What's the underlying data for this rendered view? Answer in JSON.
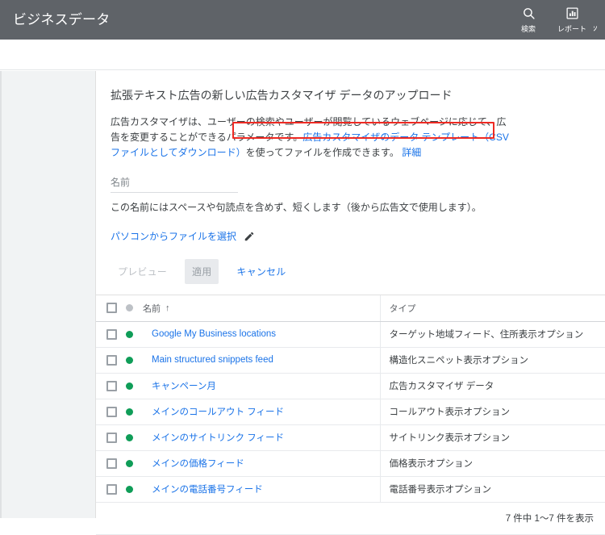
{
  "appbar": {
    "title": "ビジネスデータ",
    "actions": [
      {
        "label": "検索",
        "icon": "search-icon"
      },
      {
        "label": "レポート",
        "icon": "bar-chart-icon"
      },
      {
        "label": "ツ",
        "icon": "tools-icon"
      }
    ]
  },
  "panel": {
    "title": "拡張テキスト広告の新しい広告カスタマイザ データのアップロード",
    "description_before": "広告カスタマイザは、ユーザーの検索やユーザーが閲覧しているウェブページに応じて、広告を変更することができるパラメータです。",
    "template_link": "広告カスタマイザのデータ テンプレート（CSV ファイルとしてダウンロード）",
    "description_after": "を使ってファイルを作成できます。",
    "learn_more_link": "詳細",
    "name_field": {
      "placeholder": "名前",
      "value": ""
    },
    "name_hint": "この名前にはスペースや句読点を含めず、短くします（後から広告文で使用します）。",
    "file_pick_link": "パソコンからファイルを選択",
    "edit_icon": "pencil-icon",
    "buttons": {
      "preview": "プレビュー",
      "apply": "適用",
      "cancel": "キャンセル"
    },
    "annotation": {
      "color": "#ee2a23",
      "target": "template_link"
    }
  },
  "table": {
    "columns": {
      "name": "名前",
      "type": "タイプ"
    },
    "sort": {
      "column": "name",
      "direction": "ascending",
      "glyph": "↑"
    },
    "rows": [
      {
        "name": "Google My Business locations",
        "type": "ターゲット地域フィード、住所表示オプション",
        "status": "#0f9d58",
        "checked": false
      },
      {
        "name": "Main structured snippets feed",
        "type": "構造化スニペット表示オプション",
        "status": "#0f9d58",
        "checked": false
      },
      {
        "name": "キャンペーン月",
        "type": "広告カスタマイザ データ",
        "status": "#0f9d58",
        "checked": false
      },
      {
        "name": "メインのコールアウト フィード",
        "type": "コールアウト表示オプション",
        "status": "#0f9d58",
        "checked": false
      },
      {
        "name": "メインのサイトリンク フィード",
        "type": "サイトリンク表示オプション",
        "status": "#0f9d58",
        "checked": false
      },
      {
        "name": "メインの価格フィード",
        "type": "価格表示オプション",
        "status": "#0f9d58",
        "checked": false
      },
      {
        "name": "メインの電話番号フィード",
        "type": "電話番号表示オプション",
        "status": "#0f9d58",
        "checked": false
      }
    ],
    "footer_text": "7 件中 1〜7 件を表示"
  }
}
